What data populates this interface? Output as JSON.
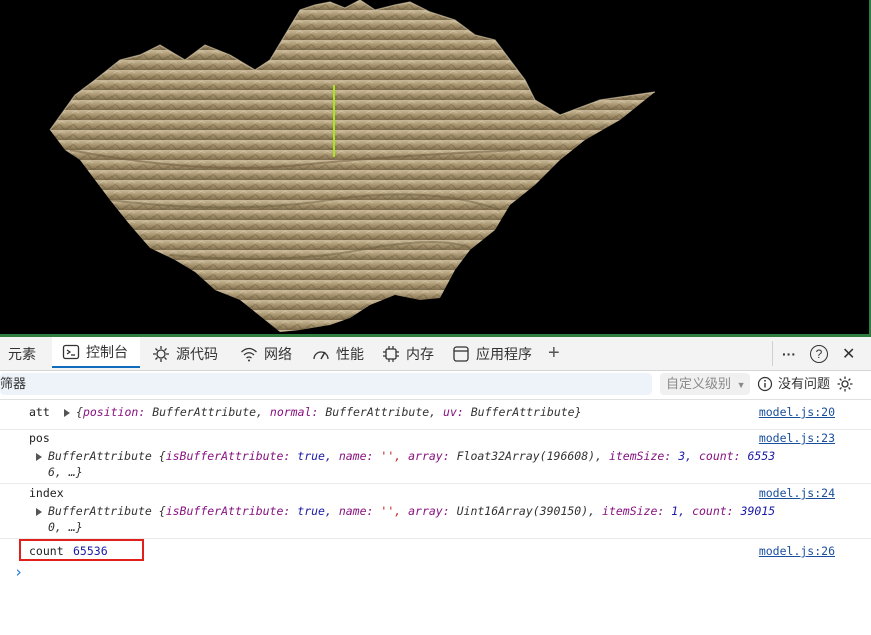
{
  "devtools": {
    "tabs": [
      {
        "label": "元素",
        "icon": "elements-icon"
      },
      {
        "label": "控制台",
        "icon": "console-icon",
        "active": true
      },
      {
        "label": "源代码",
        "icon": "sources-icon"
      },
      {
        "label": "网络",
        "icon": "wifi-icon"
      },
      {
        "label": "性能",
        "icon": "performance-icon"
      },
      {
        "label": "内存",
        "icon": "memory-icon"
      },
      {
        "label": "应用程序",
        "icon": "application-icon"
      }
    ],
    "add_tab": "+",
    "more": "···",
    "help": "?",
    "close": "✕"
  },
  "filterbar": {
    "filter_text": "筛器",
    "level_select": "自定义级别",
    "issues_label": "没有问题"
  },
  "console": {
    "att": {
      "label": "att",
      "open": "{",
      "k1": "position:",
      "v1": "BufferAttribute,",
      "k2": "normal:",
      "v2": "BufferAttribute,",
      "k3": "uv:",
      "v3": "BufferAttribute",
      "close": "}",
      "src": "model.js:20"
    },
    "pos": {
      "label": "pos",
      "line1a": "BufferAttribute {",
      "k1": "isBufferAttribute:",
      "v1": "true,",
      "k2": "name:",
      "v2": "'',",
      "k3": "array:",
      "v3": "Float32Array(196608),",
      "k4": "itemSize:",
      "v4": "3,",
      "k5": "count:",
      "v5": "6553",
      "line2": "6, …}",
      "src": "model.js:23"
    },
    "index": {
      "label": "index",
      "line1a": "BufferAttribute {",
      "k1": "isBufferAttribute:",
      "v1": "true,",
      "k2": "name:",
      "v2": "'',",
      "k3": "array:",
      "v3": "Uint16Array(390150),",
      "k4": "itemSize:",
      "v4": "1,",
      "k5": "count:",
      "v5": "39015",
      "line2": "0, …}",
      "src": "model.js:24"
    },
    "count": {
      "label": "count",
      "value": "65536",
      "src": "model.js:26"
    },
    "prompt": "›"
  },
  "colors": {
    "terrain": "#b5a282",
    "marker": "#a8e61d",
    "accent": "#0f6cbd",
    "highlight": "#e0201b"
  }
}
